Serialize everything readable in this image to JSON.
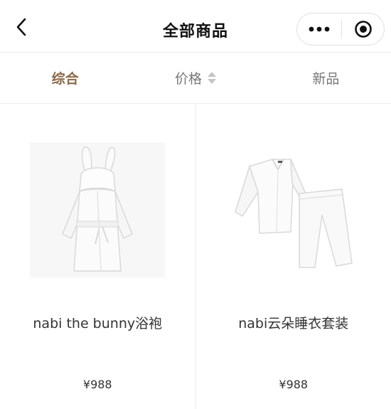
{
  "header": {
    "title": "全部商品",
    "back_icon": "chevron-left-icon",
    "more_icon": "more-dots-icon",
    "close_icon": "target-close-icon"
  },
  "tabs": [
    {
      "label": "综合",
      "active": true
    },
    {
      "label": "价格",
      "active": false,
      "sort_icon": "sort-arrows-icon"
    },
    {
      "label": "新品",
      "active": false
    }
  ],
  "products": [
    {
      "name": "nabi the bunny浴袍",
      "price": "¥988",
      "image": "white-bunny-robe"
    },
    {
      "name": "nabi云朵睡衣套装",
      "price": "¥988",
      "image": "white-pajama-set"
    }
  ],
  "colors": {
    "active_tab": "#8a6a4a",
    "divider": "#ececec",
    "text": "#333333"
  }
}
